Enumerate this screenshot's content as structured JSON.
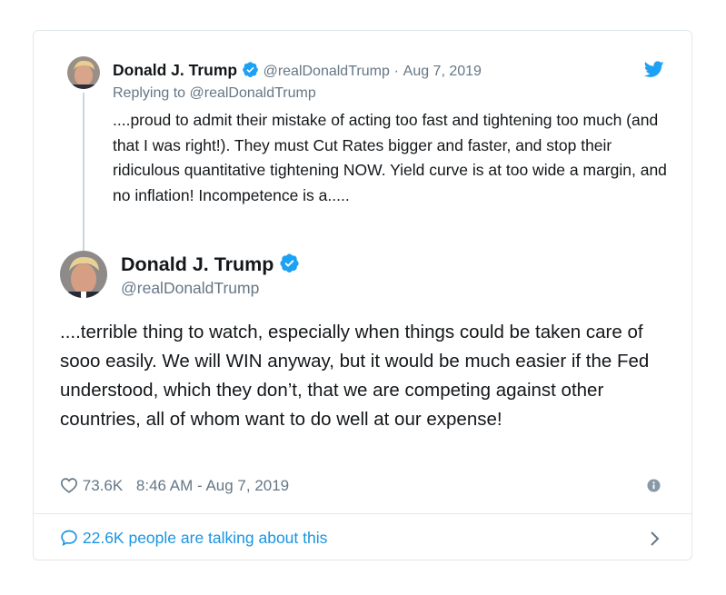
{
  "quoted_tweet": {
    "name": "Donald J. Trump",
    "handle": "@realDonaldTrump",
    "separator": "·",
    "date": "Aug 7, 2019",
    "replying_to": "Replying to @realDonaldTrump",
    "text": "....proud to admit their mistake of acting too fast and tightening too much (and that I was right!). They must Cut Rates bigger and faster, and stop their ridiculous quantitative tightening NOW. Yield curve is at too wide a margin, and no inflation! Incompetence is a....."
  },
  "main_tweet": {
    "name": "Donald J. Trump",
    "handle": "@realDonaldTrump",
    "text": "....terrible thing to watch, especially when things could be taken care of sooo easily. We will WIN anyway, but it would be much easier if the Fed understood, which they don’t, that we are competing against other countries, all of whom want to do well at our expense!",
    "likes": "73.6K",
    "timestamp": "8:46 AM - Aug 7, 2019"
  },
  "footer": {
    "talking": "22.6K people are talking about this"
  },
  "icons": {
    "verified": "verified-badge-icon",
    "bird": "twitter-bird-icon",
    "heart": "heart-icon",
    "info": "info-icon",
    "reply": "reply-bubble-icon",
    "chevron": "chevron-right-icon"
  },
  "colors": {
    "accent": "#1da1f2",
    "link": "#1b95e0",
    "text": "#14171a",
    "muted": "#657786",
    "border": "#e1e8ed"
  }
}
